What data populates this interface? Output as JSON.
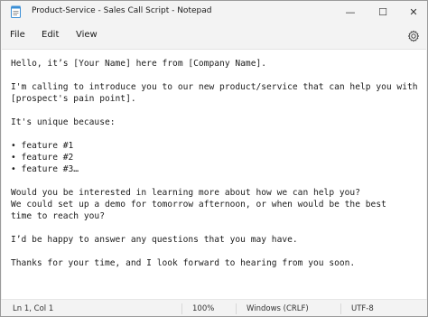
{
  "window": {
    "title": "Product-Service - Sales Call Script - Notepad",
    "minimize_glyph": "—",
    "maximize_glyph": "☐",
    "close_glyph": "✕"
  },
  "menu": {
    "file": "File",
    "edit": "Edit",
    "view": "View"
  },
  "icons": {
    "app": "notepad-icon",
    "settings": "gear-icon"
  },
  "editor": {
    "lines": [
      "Hello, it’s [Your Name] here from [Company Name].",
      "",
      "I'm calling to introduce you to our new product/service that can help you with",
      "[prospect's pain point].",
      "",
      "It's unique because:",
      "",
      "• feature #1",
      "• feature #2",
      "• feature #3…",
      "",
      "Would you be interested in learning more about how we can help you?",
      "We could set up a demo for tomorrow afternoon, or when would be the best",
      "time to reach you?",
      "",
      "I’d be happy to answer any questions that you may have.",
      "",
      "Thanks for your time, and I look forward to hearing from you soon."
    ]
  },
  "status": {
    "position": "Ln 1, Col 1",
    "zoom": "100%",
    "line_ending": "Windows (CRLF)",
    "encoding": "UTF-8"
  },
  "colors": {
    "chrome": "#f3f3f3",
    "editor_bg": "#ffffff",
    "text": "#1c1c1c",
    "icon_accent": "#3b8fd6"
  }
}
